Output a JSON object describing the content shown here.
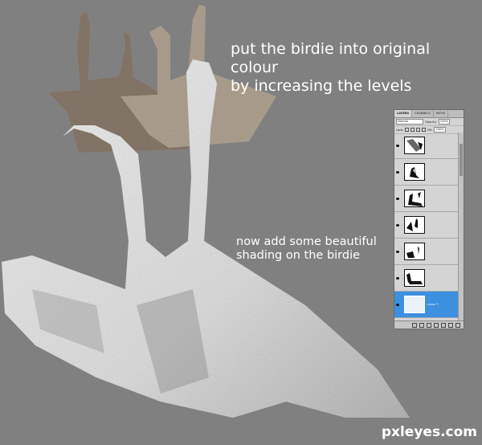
{
  "captions": {
    "step_1_line_1": "put the birdie into original colour",
    "step_1_line_2": "by increasing the levels",
    "step_2_line_1": "now add some beautiful",
    "step_2_line_2": "shading on the birdie"
  },
  "watermark": "pxleyes.com",
  "layers_panel": {
    "tabs": [
      "LAYERS",
      "CHANNELS",
      "PATHS"
    ],
    "blend_mode": "Normal",
    "opacity_label": "Opacity:",
    "opacity_value": "100%",
    "lock_label": "Lock:",
    "fill_label": "Fill:",
    "fill_value": "100%",
    "selected_layer_name": "Layer 7",
    "selection_color": "#3d8fe0"
  },
  "colors": {
    "background": "#808080",
    "caption_text": "#ffffff",
    "bird_white": "#efefef",
    "bird_brown": "#9f907f"
  }
}
